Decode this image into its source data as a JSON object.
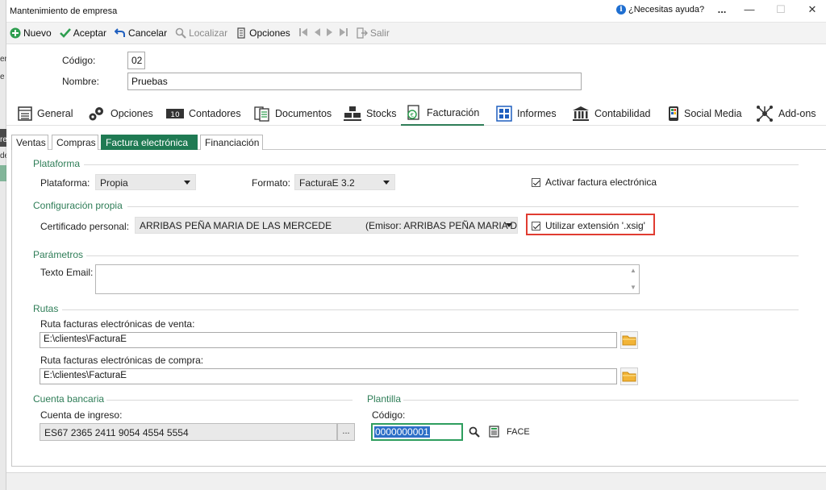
{
  "window": {
    "title": "Mantenimiento de empresa",
    "help_label": "¿Necesitas ayuda?",
    "more_label": "...",
    "minimize_label": "—",
    "maximize_label": "☐",
    "close_label": "✕"
  },
  "background_window": {
    "fragment_1": "er",
    "fragment_2": "e",
    "fragment_3": "re",
    "fragment_4": "de"
  },
  "toolbar": {
    "new_label": "Nuevo",
    "accept_label": "Aceptar",
    "cancel_label": "Cancelar",
    "locate_label": "Localizar",
    "options_label": "Opciones",
    "exit_label": "Salir"
  },
  "header": {
    "code_label": "Código:",
    "code_value": "02",
    "name_label": "Nombre:",
    "name_value": "Pruebas"
  },
  "main_tabs": [
    {
      "label": "General",
      "icon": "general-icon"
    },
    {
      "label": "Opciones",
      "icon": "gears-icon"
    },
    {
      "label": "Contadores",
      "icon": "counter-icon"
    },
    {
      "label": "Documentos",
      "icon": "documents-icon"
    },
    {
      "label": "Stocks",
      "icon": "stocks-icon"
    },
    {
      "label": "Facturación",
      "icon": "billing-icon",
      "active": true
    },
    {
      "label": "Informes",
      "icon": "reports-icon"
    },
    {
      "label": "Contabilidad",
      "icon": "accounting-icon"
    },
    {
      "label": "Social Media",
      "icon": "social-media-icon"
    },
    {
      "label": "Add-ons",
      "icon": "addons-icon"
    }
  ],
  "sub_tabs": [
    {
      "label": "Ventas"
    },
    {
      "label": "Compras"
    },
    {
      "label": "Factura electrónica",
      "active": true
    },
    {
      "label": "Financiación"
    }
  ],
  "plataforma": {
    "section_title": "Plataforma",
    "platform_label": "Plataforma:",
    "platform_value": "Propia",
    "format_label": "Formato:",
    "format_value": "FacturaE 3.2",
    "activate_label": "Activar factura electrónica",
    "activate_checked": true
  },
  "configuracion": {
    "section_title": "Configuración propia",
    "cert_label": "Certificado personal:",
    "cert_value": "ARRIBAS PEÑA MARIA DE LAS MERCEDE",
    "cert_issuer": "(Emisor: ARRIBAS PEÑA MARIA D",
    "xsig_label": "Utilizar extensión '.xsig'",
    "xsig_checked": true
  },
  "parametros": {
    "section_title": "Parámetros",
    "email_label": "Texto Email:",
    "email_value": ""
  },
  "rutas": {
    "section_title": "Rutas",
    "sales_label": "Ruta facturas electrónicas de venta:",
    "sales_value": "E:\\clientes\\FacturaE",
    "purchase_label": "Ruta facturas electrónicas de compra:",
    "purchase_value": "E:\\clientes\\FacturaE"
  },
  "cuenta": {
    "section_title": "Cuenta bancaria",
    "account_label": "Cuenta de ingreso:",
    "account_value": "ES67 2365 2411 9054 4554 5554",
    "dots_label": "..."
  },
  "plantilla": {
    "section_title": "Plantilla",
    "code_label": "Código:",
    "code_value": "0000000001",
    "template_name": "FACE"
  },
  "colors": {
    "accent": "#2e7d57",
    "active_subtab": "#1f7a53",
    "highlight_frame": "#e03c31",
    "selection": "#2d6fc7"
  }
}
